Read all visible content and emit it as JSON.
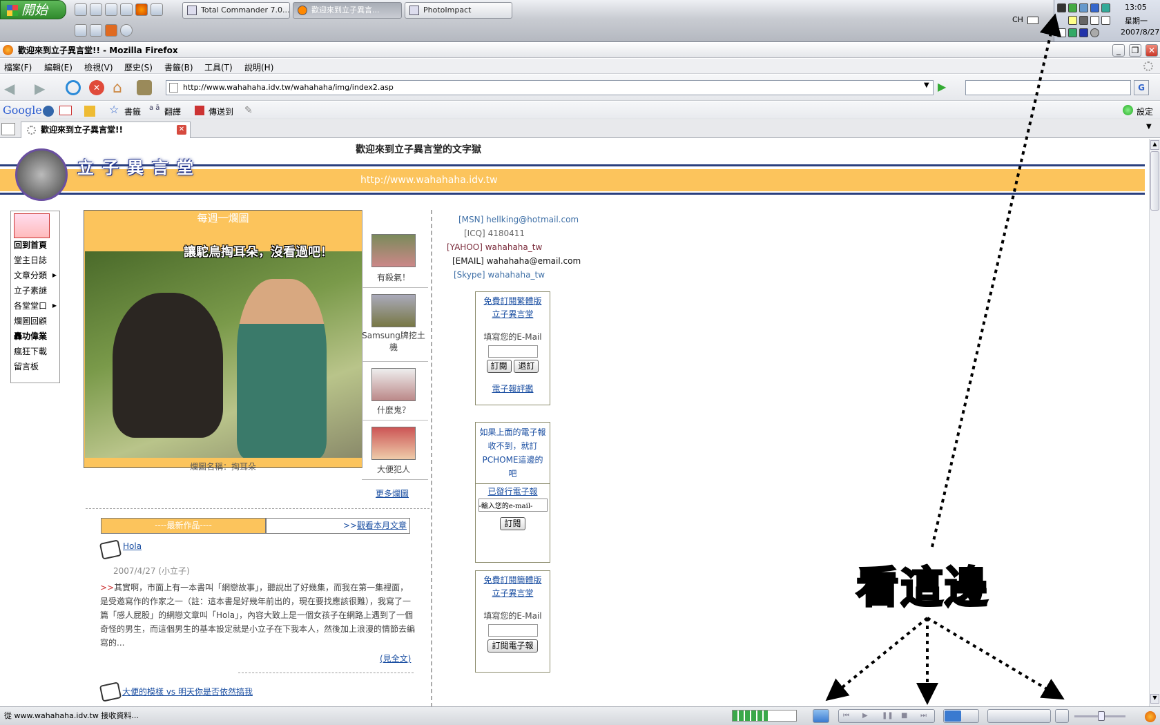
{
  "taskbar": {
    "start_label": "開始",
    "tasks": [
      "Total Commander 7.0...",
      "歡迎來到立子異言...",
      "PhotoImpact"
    ],
    "lang": "CH",
    "time": "13:05",
    "weekday": "星期一",
    "date": "2007/8/27"
  },
  "window": {
    "title": "歡迎來到立子異言堂!! - Mozilla Firefox"
  },
  "menu": [
    "檔案(F)",
    "編輯(E)",
    "檢視(V)",
    "歷史(S)",
    "書籤(B)",
    "工具(T)",
    "說明(H)"
  ],
  "nav": {
    "url": "http://www.wahahaha.idv.tw/wahahaha/img/index2.asp"
  },
  "google_bar": {
    "logo": "Google",
    "bookmarks": "書籤",
    "translate": "翻譯",
    "send": "傳送到",
    "settings": "設定"
  },
  "tab": {
    "label": "歡迎來到立子異言堂!!"
  },
  "site": {
    "logo_text": "立子異言堂",
    "welcome": "歡迎來到立子異言堂的文字獄",
    "domain": "http://www.wahahaha.idv.tw",
    "side_menu": [
      "回到首頁",
      "堂主日誌",
      "文章分類",
      "立子素謎",
      "各堂堂口",
      "爛圖回顧",
      "轟功偉業",
      "瘋狂下載",
      "留言板"
    ],
    "weekly": {
      "heading": "每週一爛圖",
      "caption": "讓駝鳥掏耳朵，沒看過吧！",
      "name": "爛圖名稱：掏耳朵",
      "more": "更多爛圖"
    },
    "thumbs": [
      "有殺氣！",
      "Samsung牌挖土機",
      "什麼鬼？",
      "大便犯人"
    ],
    "contacts": [
      {
        "label": "[MSN]",
        "value": "hellking@hotmail.com"
      },
      {
        "label": "[ICQ]",
        "value": "4180411"
      },
      {
        "label": "[YAHOO]",
        "value": "wahahaha_tw"
      },
      {
        "label": "[EMAIL]",
        "value": "wahahaha@email.com"
      },
      {
        "label": "[Skype]",
        "value": "wahahaha_tw"
      }
    ],
    "sub1": {
      "title1": "免費訂閱繁體版",
      "title2": "立子異言堂",
      "prompt": "填寫您的E-Mail",
      "subscribe": "訂閱",
      "unsub": "退訂",
      "review": "電子報評鑑"
    },
    "sub2": {
      "text": "如果上面的電子報收不到，就訂PCHOME這邊的吧",
      "issued": "已發行電子報",
      "placeholder": "-輸入您的e-mail-",
      "subscribe": "訂閱"
    },
    "sub3": {
      "title1": "免費訂閱簡體版",
      "title2": "立子異言堂",
      "prompt": "填寫您的E-Mail",
      "button": "訂閱電子報"
    },
    "latest": {
      "header": "----最新作品----",
      "month_link": "觀看本月文章",
      "month_prefix": ">>",
      "post_title": "Hola",
      "post_meta": "2007/4/27 (小立子)",
      "post_body": "其實啊，市面上有一本書叫「網戀故事」，聽說出了好幾集，而我在第一集裡面，是受邀寫作的作家之一（註：這本書是好幾年前出的，現在要找應該很難），我寫了一篇「感人屁股」的網戀文章叫「Hola」，內容大致上是一個女孩子在網路上遇到了一個奇怪的男生，而這個男生的基本設定就是小立子在下我本人，然後加上浪漫的情節去編寫的...",
      "body_prefix": ">>",
      "read_more": "(見全文)",
      "post2_title": "大便的模樣 vs 明天你是否依然搞我"
    }
  },
  "annotation": {
    "text": "看這邊"
  },
  "status": {
    "text": "從 www.wahahaha.idv.tw 接收資料..."
  }
}
